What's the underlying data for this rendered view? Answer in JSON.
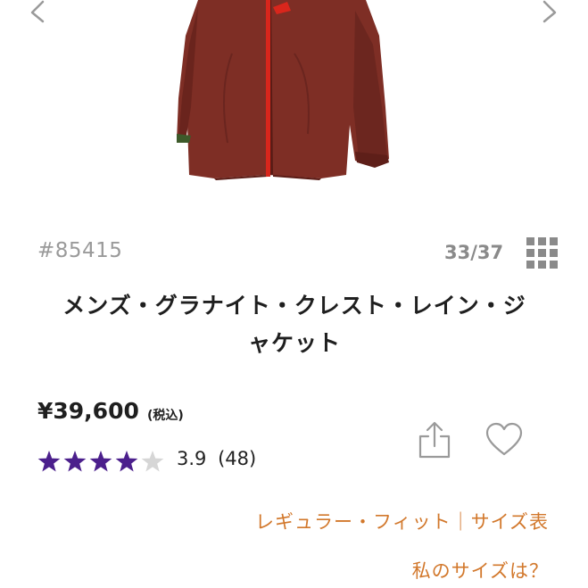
{
  "product": {
    "sku": "#85415",
    "image_counter": "33/37",
    "title_line1": "メンズ・グラナイト・クレスト・レイン・ジ",
    "title_line2": "ャケット",
    "price": "¥39,600",
    "price_note": "(税込)",
    "rating": 3.9,
    "rating_display": "3.9",
    "review_count": "(48)",
    "stars_total": 5,
    "stars_filled": 4
  },
  "links": {
    "fit": "レギュラー・フィット｜サイズ表",
    "my_size": "私のサイズは？"
  },
  "icons": {
    "prev": "chevron-left-icon",
    "next": "chevron-right-icon",
    "grid": "grid-icon",
    "share": "share-icon",
    "favorite": "heart-icon",
    "star": "star-icon"
  },
  "colors": {
    "accent_link": "#d2782c",
    "star_filled": "#4b1f8c",
    "star_empty": "#d6d6d6",
    "jacket": "#7e2e25",
    "zipper": "#d9261c"
  }
}
